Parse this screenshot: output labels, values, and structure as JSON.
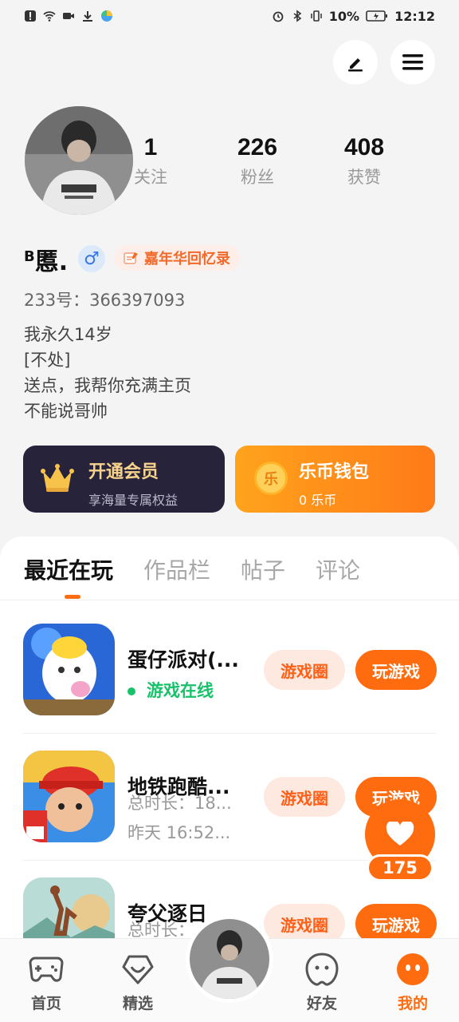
{
  "status_bar": {
    "battery": "10%",
    "time": "12:12"
  },
  "profile": {
    "stats": [
      {
        "num": "1",
        "label": "关注"
      },
      {
        "num": "226",
        "label": "粉丝"
      },
      {
        "num": "408",
        "label": "获赞"
      }
    ],
    "name_prefix": "B",
    "name": "慝.",
    "gender": "♂",
    "badge": "嘉年华回忆录",
    "uid": "233号：366397093",
    "bio": [
      "我永久14岁",
      "[不处]",
      "送点，我帮你充满主页",
      "不能说哥帅"
    ]
  },
  "cards": {
    "vip": {
      "title": "开通会员",
      "subtitle": "享海量专属权益"
    },
    "wallet": {
      "title": "乐币钱包",
      "subtitle": "0 乐币",
      "coin_glyph": "乐"
    }
  },
  "tabs": [
    {
      "label": "最近在玩",
      "active": true
    },
    {
      "label": "作品栏",
      "active": false
    },
    {
      "label": "帖子",
      "active": false
    },
    {
      "label": "评论",
      "active": false
    }
  ],
  "games": [
    {
      "title": "蛋仔派对(...",
      "online": "游戏在线",
      "circle": "游戏圈",
      "play": "玩游戏"
    },
    {
      "title": "地铁跑酷...",
      "line1": "总时长：18...",
      "line2": "昨天 16:52...",
      "circle": "游戏圈",
      "play": "玩游戏"
    },
    {
      "title": "夸父逐日",
      "line1": "总时长：",
      "circle": "游戏圈",
      "play": "玩游戏"
    }
  ],
  "float": {
    "count": "175"
  },
  "nav": [
    {
      "label": "首页",
      "icon": "gamepad-icon"
    },
    {
      "label": "精选",
      "icon": "heart-gem-icon"
    },
    {
      "label": "好友",
      "icon": "friend-face-icon"
    },
    {
      "label": "我的",
      "icon": "me-face-icon"
    }
  ],
  "colors": {
    "accent": "#ff6b0f",
    "vip_bg": "#26233a",
    "online": "#18c26b"
  }
}
